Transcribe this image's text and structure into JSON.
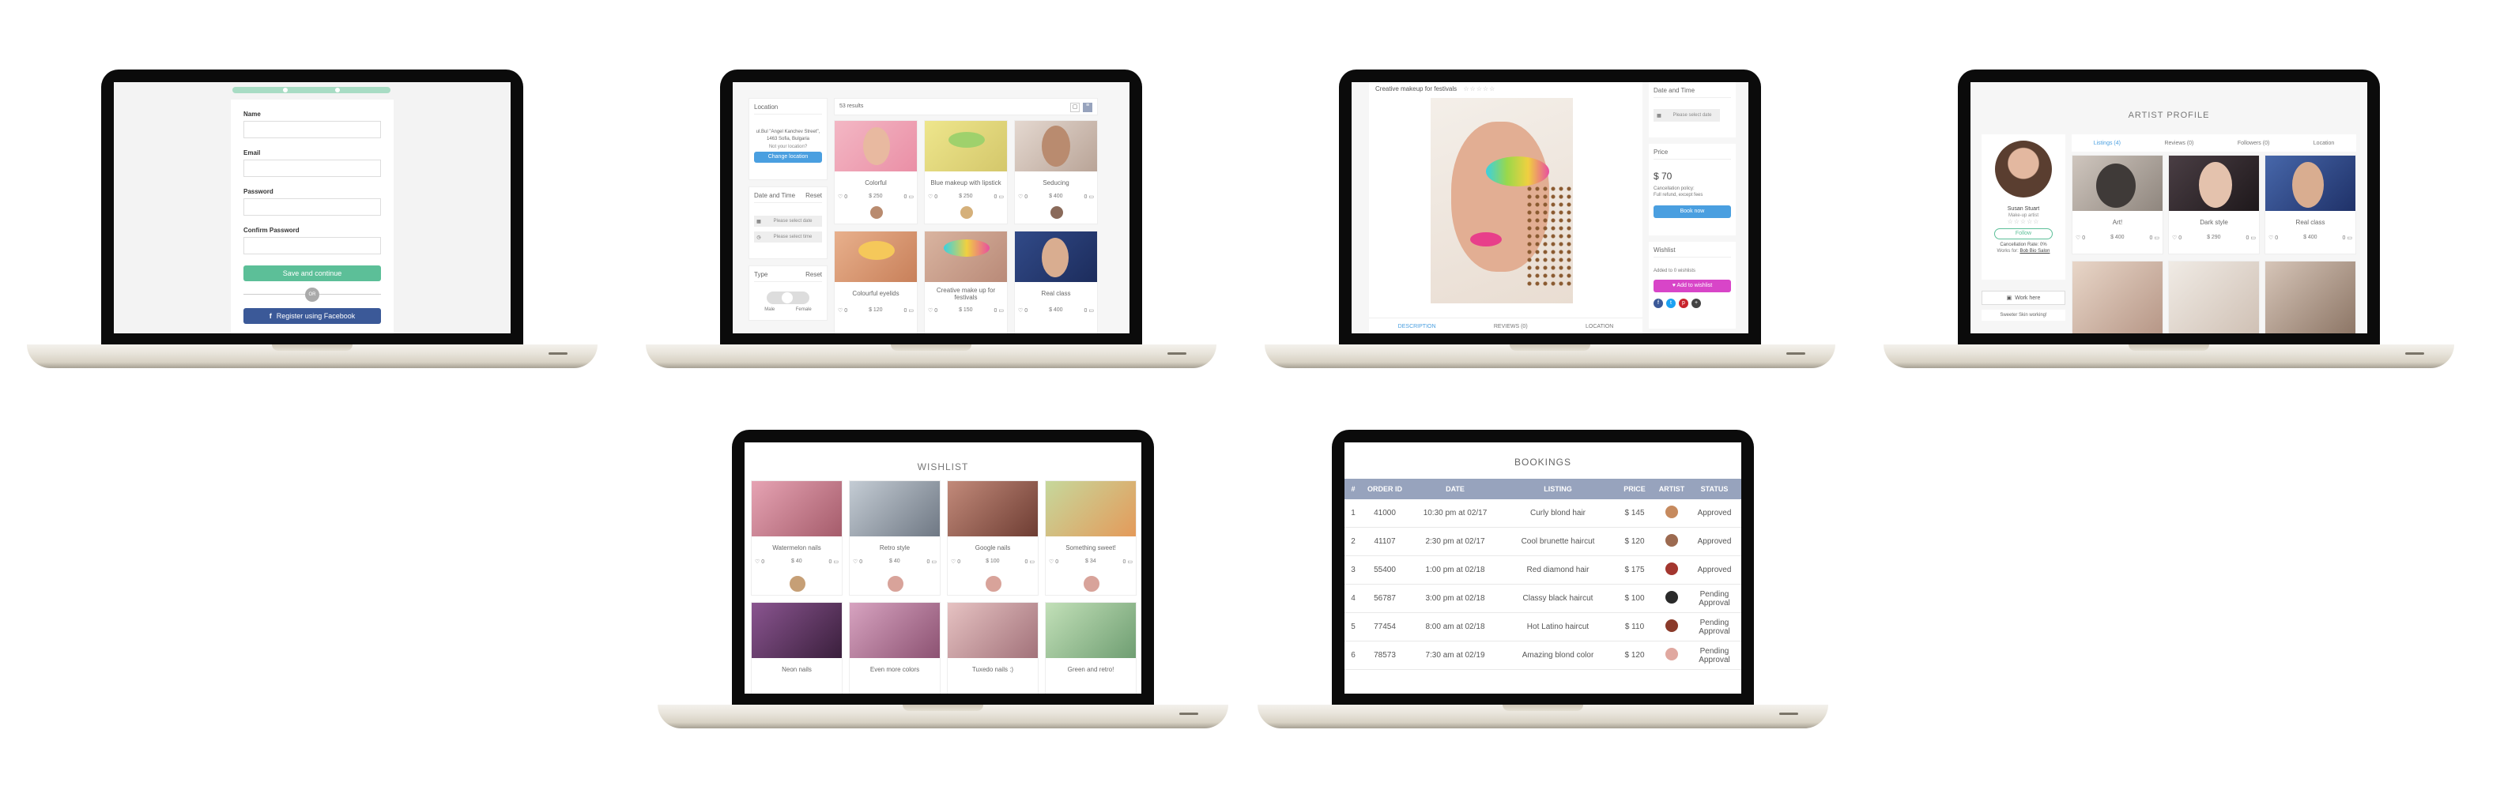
{
  "signup": {
    "name_label": "Name",
    "email_label": "Email",
    "password_label": "Password",
    "confirm_label": "Confirm Password",
    "save_button": "Save and continue",
    "or_label": "OR",
    "facebook_button": "Register using Facebook"
  },
  "search": {
    "location_label": "Location",
    "address": "ul.Bul \"Angel Kanchev Street\", 1463 Sofia, Bulgaria",
    "not_your_location": "Not your location?",
    "change_location": "Change location",
    "datetime_label": "Date and Time",
    "reset_label": "Reset",
    "date_placeholder": "Please select date",
    "time_placeholder": "Please select time",
    "type_label": "Type",
    "type_reset": "Reset",
    "male_label": "Male",
    "female_label": "Female",
    "results_count": "53 results",
    "results": [
      {
        "caption": "Colorful",
        "likes": "0",
        "price": "$ 250",
        "comments": "0",
        "bg": "#f0a8b8",
        "skin": "#e8b9a0"
      },
      {
        "caption": "Blue makeup with lipstick",
        "likes": "0",
        "price": "$ 250",
        "comments": "0",
        "bg": "#e6dc7e",
        "skin": "#d9c77a"
      },
      {
        "caption": "Seducing",
        "likes": "0",
        "price": "$ 400",
        "comments": "0",
        "bg": "#d7c9c0",
        "skin": "#b98b6f"
      },
      {
        "caption": "Colourful eyelids",
        "likes": "0",
        "price": "$ 120",
        "comments": "0",
        "bg": "#d89a73",
        "skin": "#e0a785"
      },
      {
        "caption": "Creative make up for festivals",
        "likes": "0",
        "price": "$ 150",
        "comments": "0",
        "bg": "#c9a089",
        "skin": "#d8b49a"
      },
      {
        "caption": "Real class",
        "likes": "0",
        "price": "$ 400",
        "comments": "0",
        "bg": "#2b3f75",
        "skin": "#d9ad90"
      }
    ]
  },
  "listing": {
    "title": "Creative makeup for festivals",
    "date_label": "Date and Time",
    "date_placeholder": "Please select date",
    "price_label": "Price",
    "price": "$ 70",
    "cancel_line1": "Cancellation policy:",
    "cancel_line2": "Full refund, except fees",
    "book_button": "Book now",
    "wishlist_label": "Wishlist",
    "wishlist_count": "Added to 0 wishlists",
    "add_wishlist_button": "Add to wishlist",
    "tabs": [
      "DESCRIPTION",
      "REVIEWS (0)",
      "LOCATION"
    ]
  },
  "profile": {
    "title": "ARTIST PROFILE",
    "tabs": [
      "Listings (4)",
      "Reviews (0)",
      "Followers (0)",
      "Location"
    ],
    "name": "Susan Stuart",
    "role": "Make-up artist",
    "follow_button": "Follow",
    "cancel_rate": "Cancellation Rate: 0%",
    "works_for_label": "Works for:",
    "works_for_link": "Bob Bio Salon",
    "work_here_button": "Work here",
    "salon_note": "Sweeter Skin working!",
    "listings": [
      {
        "caption": "Art!",
        "likes": "0",
        "price": "$ 400",
        "comments": "0",
        "bg": "#b9b0a8"
      },
      {
        "caption": "Dark style",
        "likes": "0",
        "price": "$ 290",
        "comments": "0",
        "bg": "#3b3035"
      },
      {
        "caption": "Real class",
        "likes": "0",
        "price": "$ 400",
        "comments": "0",
        "bg": "#3e5a9a"
      }
    ]
  },
  "wishlist": {
    "title": "WISHLIST",
    "items": [
      {
        "caption": "Watermelon nails",
        "likes": "0",
        "price": "$ 40",
        "comments": "0",
        "bg": "#c98593"
      },
      {
        "caption": "Retro style",
        "likes": "0",
        "price": "$ 40",
        "comments": "0",
        "bg": "#9ba4ad"
      },
      {
        "caption": "Google nails",
        "likes": "0",
        "price": "$ 100",
        "comments": "0",
        "bg": "#a26a5c"
      },
      {
        "caption": "Something sweet!",
        "likes": "0",
        "price": "$ 34",
        "comments": "0",
        "bg": "#9fb57c"
      },
      {
        "caption": "Neon nails",
        "bg": "#6a3f6d"
      },
      {
        "caption": "Even more colors",
        "bg": "#b788a0"
      },
      {
        "caption": "Tuxedo nails :)",
        "bg": "#c8a0a2"
      },
      {
        "caption": "Green and retro!",
        "bg": "#9cbf98"
      }
    ]
  },
  "bookings": {
    "title": "BOOKINGS",
    "headers": [
      "#",
      "ORDER ID",
      "DATE",
      "LISTING",
      "PRICE",
      "ARTIST",
      "STATUS"
    ],
    "rows": [
      {
        "n": "1",
        "id": "41000",
        "date": "10:30 pm at 02/17",
        "listing": "Curly blond hair",
        "price": "$ 145",
        "status": "Approved"
      },
      {
        "n": "2",
        "id": "41107",
        "date": "2:30 pm at 02/17",
        "listing": "Cool brunette haircut",
        "price": "$ 120",
        "status": "Approved"
      },
      {
        "n": "3",
        "id": "55400",
        "date": "1:00 pm at 02/18",
        "listing": "Red diamond hair",
        "price": "$ 175",
        "status": "Approved"
      },
      {
        "n": "4",
        "id": "56787",
        "date": "3:00 pm at 02/18",
        "listing": "Classy black haircut",
        "price": "$ 100",
        "status": "Pending Approval"
      },
      {
        "n": "5",
        "id": "77454",
        "date": "8:00 am at 02/18",
        "listing": "Hot Latino haircut",
        "price": "$ 110",
        "status": "Pending Approval"
      },
      {
        "n": "6",
        "id": "78573",
        "date": "7:30 am at 02/19",
        "listing": "Amazing blond color",
        "price": "$ 120",
        "status": "Pending Approval"
      }
    ]
  },
  "colors": {
    "green": "#5cbf98",
    "blue": "#4a9fe0",
    "facebook": "#3b5998",
    "magenta": "#d845c8",
    "header": "#97a3bd"
  },
  "icons": [
    "heart-icon",
    "comment-icon",
    "calendar-icon",
    "clock-icon",
    "facebook-icon",
    "twitter-icon",
    "pinterest-icon",
    "heart-wishlist-icon",
    "briefcase-icon"
  ]
}
